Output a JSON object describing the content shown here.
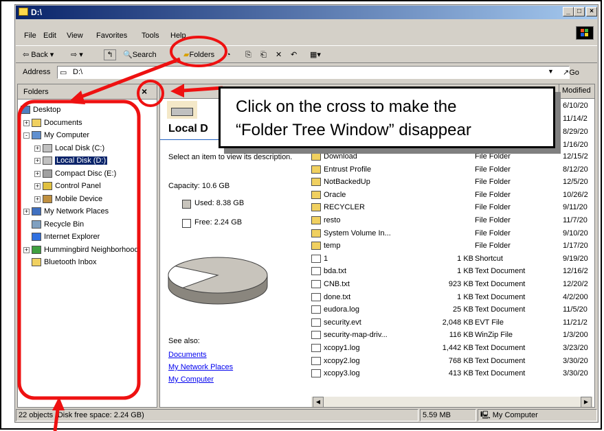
{
  "window": {
    "title": "D:\\",
    "min": "_",
    "max": "□",
    "close": "×"
  },
  "menu": [
    "File",
    "Edit",
    "View",
    "Favorites",
    "Tools",
    "Help"
  ],
  "toolbar": {
    "back": "Back",
    "search": "Search",
    "folders": "Folders"
  },
  "address": {
    "label": "Address",
    "value": "D:\\",
    "go": "Go"
  },
  "folders_pane": {
    "title": "Folders",
    "close": "×",
    "items": [
      {
        "label": "Desktop"
      },
      {
        "label": "Documents"
      },
      {
        "label": "My Computer"
      },
      {
        "label": "Local Disk (C:)"
      },
      {
        "label": "Local Disk (D:)"
      },
      {
        "label": "Compact Disc (E:)"
      },
      {
        "label": "Control Panel"
      },
      {
        "label": "Mobile Device"
      },
      {
        "label": "My Network Places"
      },
      {
        "label": "Recycle Bin"
      },
      {
        "label": "Internet Explorer"
      },
      {
        "label": "Hummingbird Neighborhood"
      },
      {
        "label": "Bluetooth Inbox"
      }
    ]
  },
  "info_panel": {
    "title": "Local D",
    "description": "Select an item to view its description.",
    "capacity": "Capacity: 10.6 GB",
    "used": "Used: 8.38 GB",
    "free": "Free: 2.24 GB",
    "see_also": "See also:",
    "links": [
      "Documents",
      "My Network Places",
      "My Computer"
    ]
  },
  "columns": {
    "modified": "Modified"
  },
  "partial_dates_top": [
    "6/10/20",
    "11/14/2",
    "8/29/20",
    "1/16/20"
  ],
  "files": [
    {
      "name": "Download",
      "size": "",
      "type": "File Folder",
      "modified": "12/15/2"
    },
    {
      "name": "Entrust Profile",
      "size": "",
      "type": "File Folder",
      "modified": "8/12/20"
    },
    {
      "name": "NotBackedUp",
      "size": "",
      "type": "File Folder",
      "modified": "12/5/20"
    },
    {
      "name": "Oracle",
      "size": "",
      "type": "File Folder",
      "modified": "10/26/2"
    },
    {
      "name": "RECYCLER",
      "size": "",
      "type": "File Folder",
      "modified": "9/11/20"
    },
    {
      "name": "resto",
      "size": "",
      "type": "File Folder",
      "modified": "11/7/20"
    },
    {
      "name": "System Volume In...",
      "size": "",
      "type": "File Folder",
      "modified": "9/10/20"
    },
    {
      "name": "temp",
      "size": "",
      "type": "File Folder",
      "modified": "1/17/20"
    },
    {
      "name": "1",
      "size": "1 KB",
      "type": "Shortcut",
      "modified": "9/19/20"
    },
    {
      "name": "bda.txt",
      "size": "1 KB",
      "type": "Text Document",
      "modified": "12/16/2"
    },
    {
      "name": "CNB.txt",
      "size": "923 KB",
      "type": "Text Document",
      "modified": "12/20/2"
    },
    {
      "name": "done.txt",
      "size": "1 KB",
      "type": "Text Document",
      "modified": "4/2/200"
    },
    {
      "name": "eudora.log",
      "size": "25 KB",
      "type": "Text Document",
      "modified": "11/5/20"
    },
    {
      "name": "security.evt",
      "size": "2,048 KB",
      "type": "EVT File",
      "modified": "11/21/2"
    },
    {
      "name": "security-map-driv...",
      "size": "116 KB",
      "type": "WinZip File",
      "modified": "1/3/200"
    },
    {
      "name": "xcopy1.log",
      "size": "1,442 KB",
      "type": "Text Document",
      "modified": "3/23/20"
    },
    {
      "name": "xcopy2.log",
      "size": "768 KB",
      "type": "Text Document",
      "modified": "3/30/20"
    },
    {
      "name": "xcopy3.log",
      "size": "413 KB",
      "type": "Text Document",
      "modified": "3/30/20"
    }
  ],
  "status": {
    "objects": "22 objects (Disk free space: 2.24 GB)",
    "size": "5.59 MB",
    "location": "My Computer"
  },
  "callout": {
    "line1": "Click on the cross to make the",
    "line2": "“Folder Tree Window” disappear"
  },
  "colors": {
    "annotation": "#ee1111",
    "title_bar": "#0a246a",
    "selection": "#0a246a",
    "pie_used": "#c8c4bc",
    "pie_free": "#ffffff"
  },
  "disk_usage": {
    "used_fraction": 0.79
  }
}
